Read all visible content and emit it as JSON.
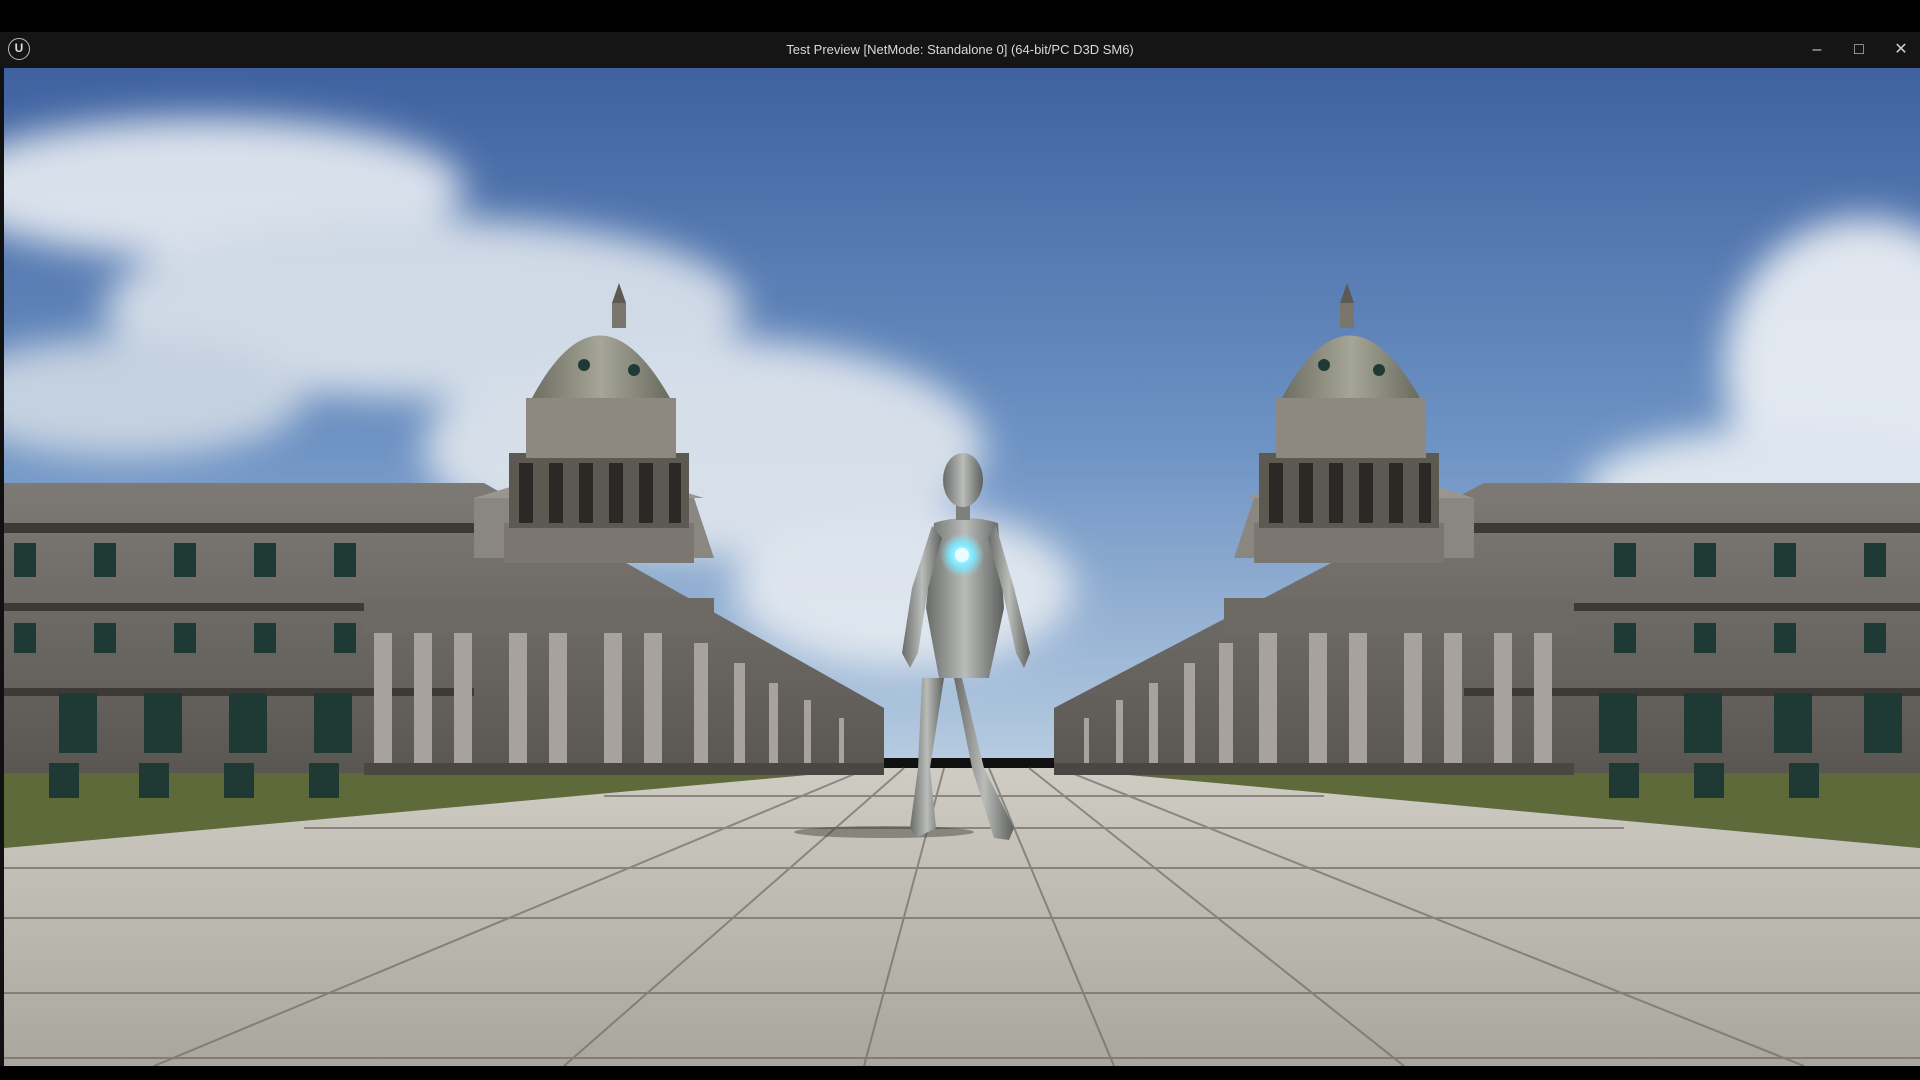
{
  "window": {
    "title": "Test Preview [NetMode: Standalone 0]  (64-bit/PC D3D SM6)",
    "logo_text": "U",
    "minimize_glyph": "–",
    "maximize_glyph": "□",
    "close_glyph": "✕"
  },
  "scene": {
    "description_icons": [
      "unreal-engine-logo-icon",
      "minimize-icon",
      "maximize-icon",
      "close-icon"
    ],
    "colors": {
      "sky_top": "#4a6fa8",
      "sky_horizon": "#a9c3de",
      "pavement": "#bdbab1",
      "grass": "#5f6a3a",
      "building": "#6f6b66",
      "character": "#8f9290",
      "chest_glow": "#7fe8ff"
    }
  }
}
